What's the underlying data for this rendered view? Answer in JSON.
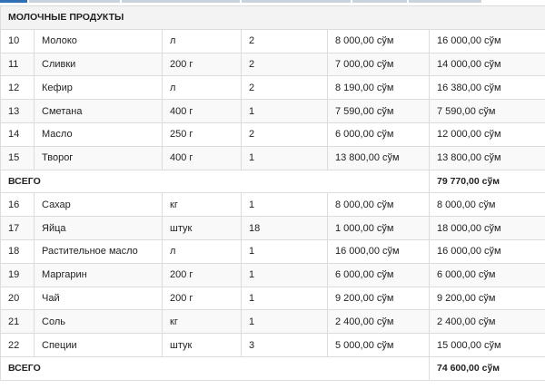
{
  "section_header": "МОЛОЧНЫЕ ПРОДУКТЫ",
  "group1": [
    {
      "num": "10",
      "name": "Молоко",
      "unit": "л",
      "qty": "2",
      "price": "8 000,00 сўм",
      "sum": "16 000,00 сўм"
    },
    {
      "num": "11",
      "name": "Сливки",
      "unit": "200 г",
      "qty": "2",
      "price": "7 000,00 сўм",
      "sum": "14 000,00 сўм"
    },
    {
      "num": "12",
      "name": "Кефир",
      "unit": "л",
      "qty": "2",
      "price": "8 190,00 сўм",
      "sum": "16 380,00 сўм"
    },
    {
      "num": "13",
      "name": "Сметана",
      "unit": "400 г",
      "qty": "1",
      "price": "7 590,00 сўм",
      "sum": "7 590,00 сўм"
    },
    {
      "num": "14",
      "name": "Масло",
      "unit": "250 г",
      "qty": "2",
      "price": "6 000,00 сўм",
      "sum": "12 000,00 сўм"
    },
    {
      "num": "15",
      "name": "Творог",
      "unit": "400 г",
      "qty": "1",
      "price": "13 800,00 сўм",
      "sum": "13 800,00 сўм"
    }
  ],
  "total1": {
    "label": "ВСЕГО",
    "value": "79 770,00 сўм"
  },
  "group2": [
    {
      "num": "16",
      "name": "Сахар",
      "unit": "кг",
      "qty": "1",
      "price": "8 000,00 сўм",
      "sum": "8 000,00 сўм"
    },
    {
      "num": "17",
      "name": "Яйца",
      "unit": "штук",
      "qty": "18",
      "price": "1 000,00 сўм",
      "sum": "18 000,00 сўм"
    },
    {
      "num": "18",
      "name": "Растительное масло",
      "unit": "л",
      "qty": "1",
      "price": "16 000,00 сўм",
      "sum": "16 000,00 сўм"
    },
    {
      "num": "19",
      "name": "Маргарин",
      "unit": "200 г",
      "qty": "1",
      "price": "6 000,00 сўм",
      "sum": "6 000,00 сўм"
    },
    {
      "num": "20",
      "name": "Чай",
      "unit": "200 г",
      "qty": "1",
      "price": "9 200,00 сўм",
      "sum": "9 200,00 сўм"
    },
    {
      "num": "21",
      "name": "Соль",
      "unit": "кг",
      "qty": "1",
      "price": "2 400,00 сўм",
      "sum": "2 400,00 сўм"
    },
    {
      "num": "22",
      "name": "Специи",
      "unit": "штук",
      "qty": "3",
      "price": "5 000,00 сўм",
      "sum": "15 000,00 сўм"
    }
  ],
  "total2": {
    "label": "ВСЕГО",
    "value": "74 600,00 сўм"
  },
  "colors": {
    "border": "#dcdcdc",
    "section_bg": "#f3f3f3",
    "accent": "#2e6fb6"
  }
}
